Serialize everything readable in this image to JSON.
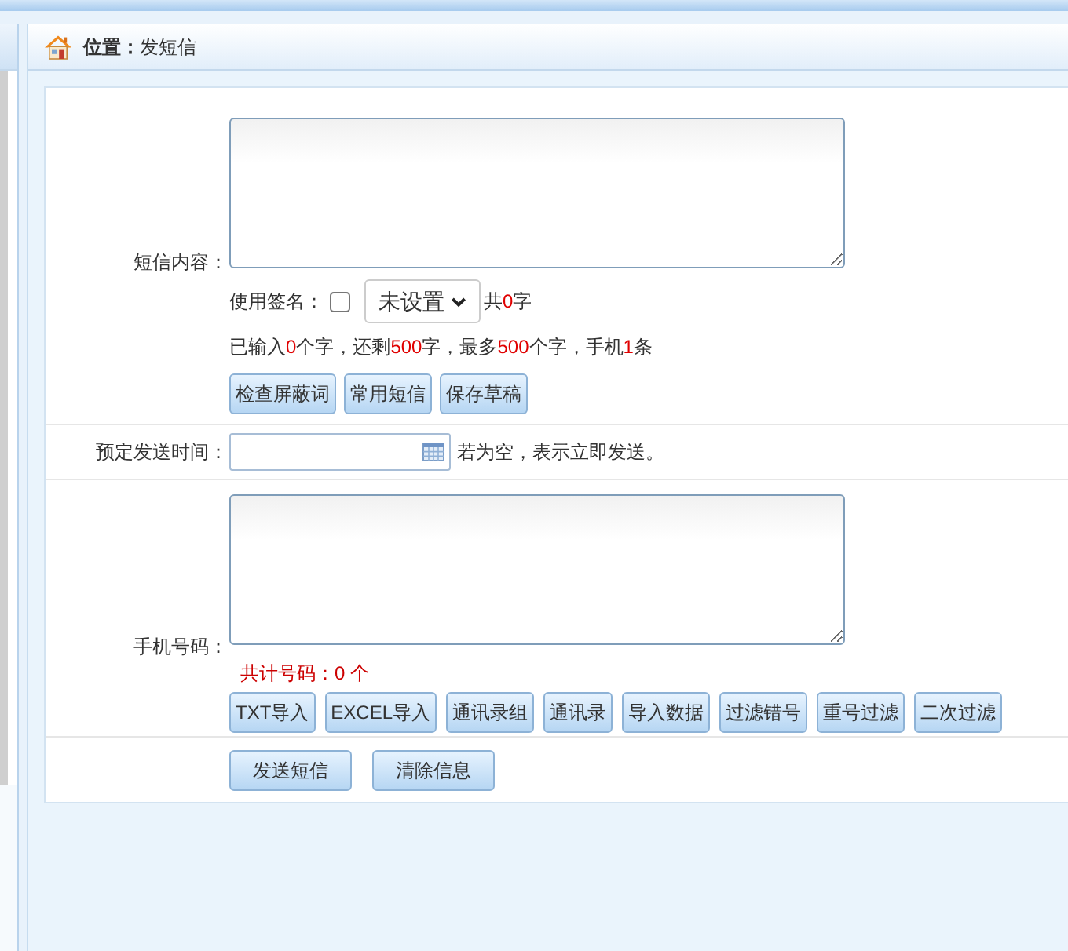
{
  "breadcrumb": {
    "label": "位置：",
    "current": "发短信"
  },
  "form": [
    {
      "kind": "message",
      "label": "短信内容：",
      "signature": {
        "label": "使用签名：",
        "checked": false,
        "select": "未设置",
        "count": [
          {
            "text": "共",
            "highlight": false
          },
          {
            "text": "0",
            "highlight": true
          },
          {
            "text": "字",
            "highlight": false
          }
        ]
      },
      "stats": [
        {
          "text": "已输入",
          "highlight": false
        },
        {
          "text": "0",
          "highlight": true
        },
        {
          "text": "个字，还剩",
          "highlight": false
        },
        {
          "text": "500",
          "highlight": true
        },
        {
          "text": "字，最多",
          "highlight": false
        },
        {
          "text": "500",
          "highlight": true
        },
        {
          "text": "个字，手机",
          "highlight": false
        },
        {
          "text": "1",
          "highlight": true
        },
        {
          "text": "条",
          "highlight": false
        }
      ],
      "buttons": [
        "检查屏蔽词",
        "常用短信",
        "保存草稿"
      ]
    },
    {
      "kind": "schedule",
      "label": "预定发送时间：",
      "hint": "若为空，表示立即发送。"
    },
    {
      "kind": "numbers",
      "label": "手机号码：",
      "total": "共计号码：0 个",
      "buttons": [
        "TXT导入",
        "EXCEL导入",
        "通讯录组",
        "通讯录",
        "导入数据",
        "过滤错号",
        "重号过滤",
        "二次过滤"
      ]
    },
    {
      "kind": "actions",
      "buttons": [
        "发送短信",
        "清除信息"
      ]
    }
  ]
}
